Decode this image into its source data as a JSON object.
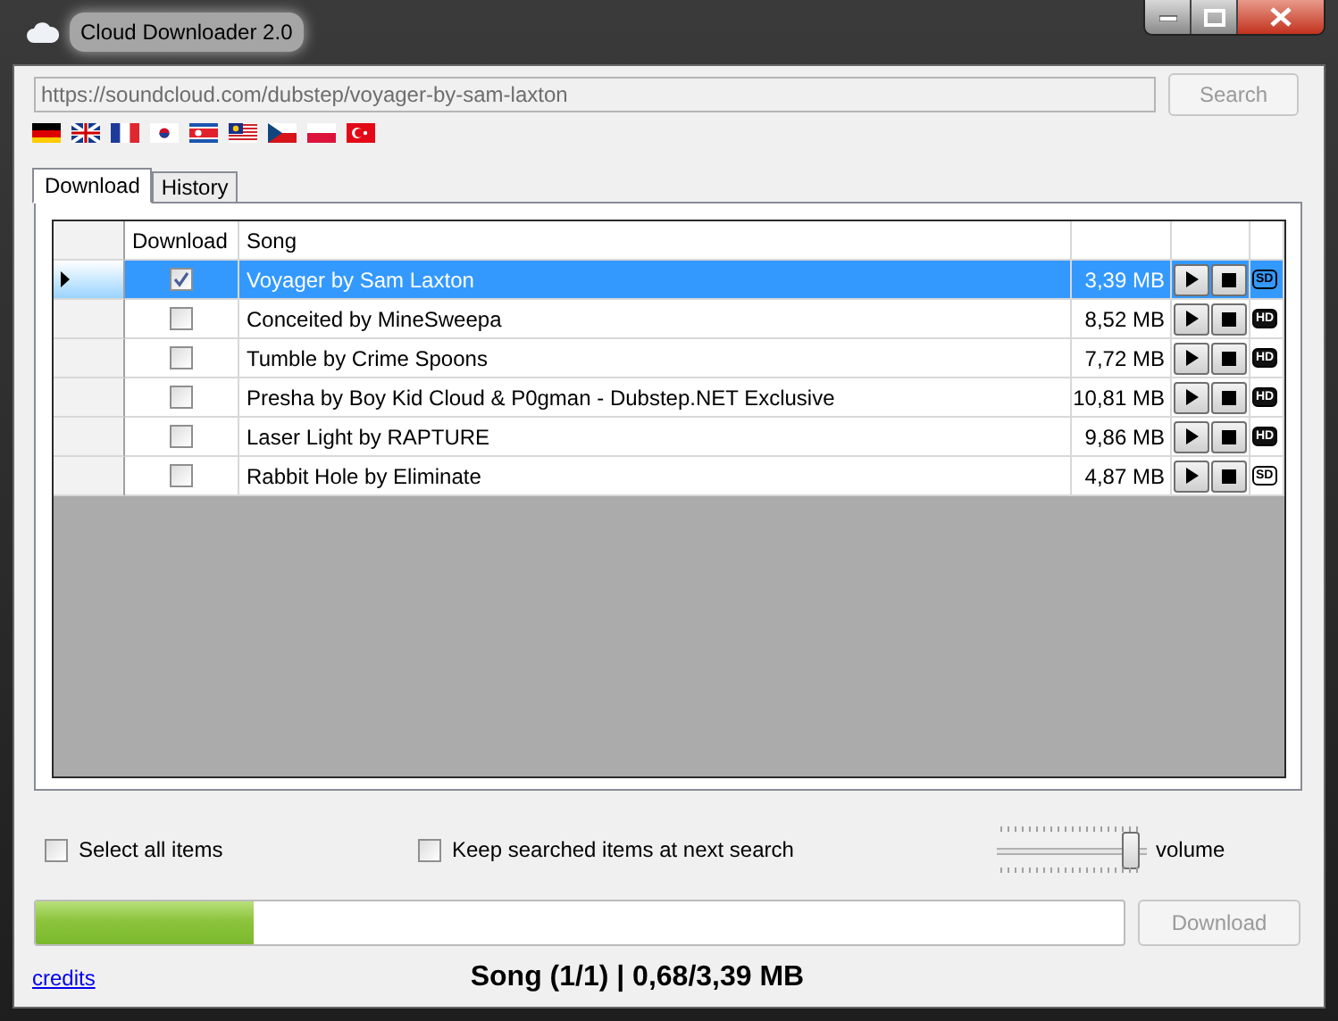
{
  "window": {
    "title": "Cloud Downloader 2.0"
  },
  "url_field": {
    "value": "https://soundcloud.com/dubstep/voyager-by-sam-laxton"
  },
  "search_button": {
    "label": "Search",
    "disabled": true
  },
  "tabs": [
    {
      "label": "Download",
      "selected": true
    },
    {
      "label": "History",
      "selected": false
    }
  ],
  "grid": {
    "columns": [
      "Download",
      "Song"
    ],
    "rows": [
      {
        "song": "Voyager by Sam Laxton",
        "size": "3,39 MB",
        "quality": "SD",
        "checked": true,
        "selected": true
      },
      {
        "song": "Conceited by MineSweepa",
        "size": "8,52 MB",
        "quality": "HD",
        "checked": false,
        "selected": false
      },
      {
        "song": "Tumble by Crime Spoons",
        "size": "7,72 MB",
        "quality": "HD",
        "checked": false,
        "selected": false
      },
      {
        "song": "Presha by Boy Kid Cloud & P0gman - Dubstep.NET Exclusive",
        "size": "10,81 MB",
        "quality": "HD",
        "checked": false,
        "selected": false
      },
      {
        "song": "Laser Light by RAPTURE",
        "size": "9,86 MB",
        "quality": "HD",
        "checked": false,
        "selected": false
      },
      {
        "song": "Rabbit Hole by Eliminate",
        "size": "4,87 MB",
        "quality": "SD",
        "checked": false,
        "selected": false
      }
    ]
  },
  "select_all": {
    "label": "Select all items",
    "checked": false
  },
  "keep_searched": {
    "label": "Keep searched items at next search",
    "checked": false
  },
  "volume": {
    "label": "volume",
    "level": 0.95
  },
  "progress": {
    "level": 0.2
  },
  "download_button": {
    "label": "Download",
    "disabled": true
  },
  "credits_link": "credits",
  "status": "Song (1/1) | 0,68/3,39 MB"
}
